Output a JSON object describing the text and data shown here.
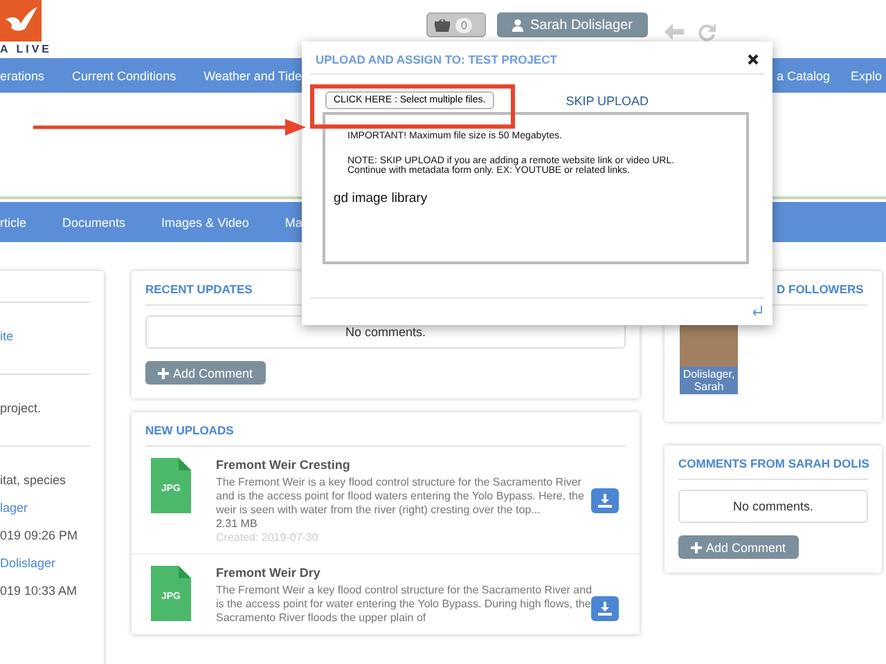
{
  "header": {
    "logo_text": "A LIVE",
    "cart_count": "0",
    "user_name": "Sarah Dolislager"
  },
  "nav": {
    "left": [
      "erations",
      "Current Conditions",
      "Weather and Tide"
    ],
    "right": [
      "a Catalog",
      "Explo"
    ]
  },
  "subnav": [
    "rticle",
    "Documents",
    "Images & Video",
    "Ma"
  ],
  "left_panel": {
    "sections": [
      {
        "lines": [
          {
            "kind": "link",
            "text": "ite"
          }
        ]
      },
      {
        "lines": [
          {
            "kind": "text",
            "text": "project."
          }
        ]
      },
      {
        "lines": [
          {
            "kind": "text",
            "text": "itat, species"
          },
          {
            "kind": "link",
            "text": "lager"
          },
          {
            "kind": "text",
            "text": "019 09:26 PM"
          },
          {
            "kind": "link",
            "text": "Dolislager"
          },
          {
            "kind": "text",
            "text": "019 10:33 AM"
          }
        ]
      }
    ]
  },
  "recent_updates": {
    "title": "RECENT UPDATES",
    "empty_text": "No comments.",
    "add_button": "Add Comment"
  },
  "new_uploads": {
    "title": "NEW UPLOADS",
    "items": [
      {
        "file_type": "JPG",
        "title": "Fremont Weir Cresting",
        "description": "The Fremont Weir is a key flood control structure for the Sacramento River and is the access point for flood waters entering the Yolo Bypass. Here, the weir is seen with water from the river (right) cresting over the top...",
        "size": "2.31 MB",
        "created": "Created: 2019-07-30"
      },
      {
        "file_type": "JPG",
        "title": "Fremont Weir Dry",
        "description": "The Fremont Weir a key flood control structure for the Sacramento River and is the access point for water entering the Yolo Bypass. During high flows, the Sacramento River floods the upper plain of"
      }
    ]
  },
  "followers": {
    "title": "D FOLLOWERS",
    "items": [
      {
        "caption": "Dolislager, Sarah"
      }
    ]
  },
  "comments": {
    "title": "COMMENTS FROM SARAH DOLIS",
    "empty_text": "No comments.",
    "add_button": "Add Comment"
  },
  "modal": {
    "title": "UPLOAD AND ASSIGN TO: TEST PROJECT",
    "select_button": "CLICK HERE : Select multiple files.",
    "skip_link": "SKIP UPLOAD",
    "important": "IMPORTANT! Maximum file size is 50 Megabytes.",
    "note": "NOTE: SKIP UPLOAD if you are adding a remote website link or video URL. Continue with metadata form only. EX: YOUTUBE or related links.",
    "library": "gd image library"
  }
}
